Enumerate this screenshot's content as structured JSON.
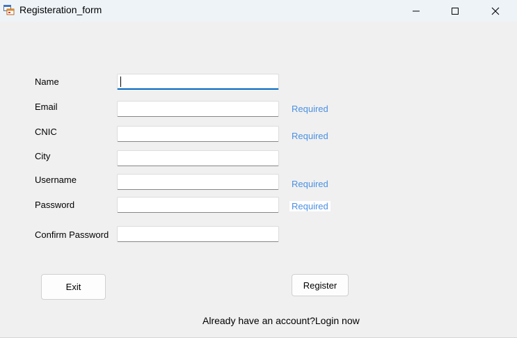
{
  "window": {
    "title": "Registeration_form",
    "icon": "app-form-icon"
  },
  "titlebar_buttons": {
    "minimize_icon": "minimize-icon",
    "maximize_icon": "maximize-icon",
    "close_icon": "close-icon"
  },
  "form": {
    "fields": [
      {
        "label": "Name",
        "value": "",
        "required_text": ""
      },
      {
        "label": "Email",
        "value": "",
        "required_text": "Required"
      },
      {
        "label": "CNIC",
        "value": "",
        "required_text": "Required"
      },
      {
        "label": "City",
        "value": "",
        "required_text": ""
      },
      {
        "label": "Username",
        "value": "",
        "required_text": "Required"
      },
      {
        "label": "Password",
        "value": "",
        "required_text": "Required"
      },
      {
        "label": "Confirm Password",
        "value": "",
        "required_text": ""
      }
    ]
  },
  "buttons": {
    "exit_label": "Exit",
    "register_label": "Register"
  },
  "footer": {
    "login_text": "Already have an account?Login now"
  },
  "colors": {
    "focus_accent": "#0067c0",
    "required_text": "#4a90e2",
    "background": "#f0f0f0"
  }
}
